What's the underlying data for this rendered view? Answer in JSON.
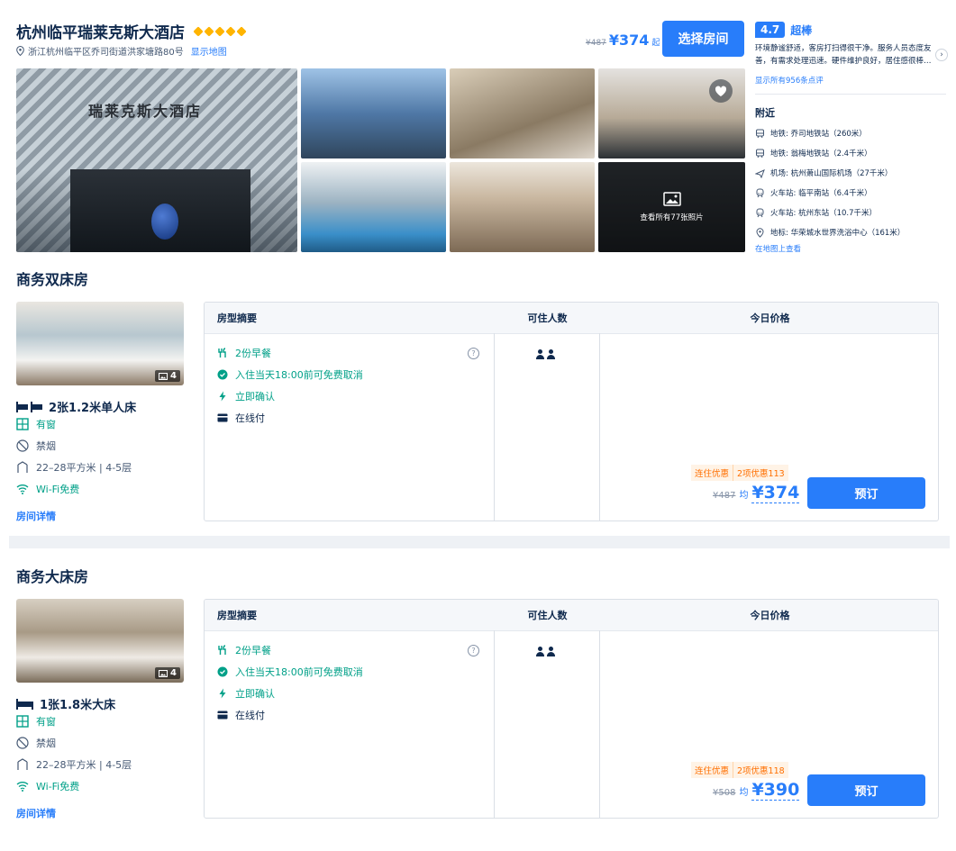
{
  "hotel": {
    "name": "杭州临平瑞莱克斯大酒店",
    "stars": 5,
    "address": "浙江杭州临平区乔司街道洪家塘路80号",
    "show_map": "显示地图",
    "price_old": "¥487",
    "price_new": "¥374",
    "price_suffix": "起",
    "select_button": "选择房间"
  },
  "review": {
    "score": "4.7",
    "word": "超棒",
    "text": "环境静谧舒适，客房打扫得很干净。服务人员态度友善，有需求处理迅速。硬件维护良好，居住感很棒…",
    "all_reviews": "显示所有956条点评"
  },
  "nearby": {
    "title": "附近",
    "items": [
      {
        "icon": "metro-icon",
        "label": "地铁: 乔司地铁站（260米）"
      },
      {
        "icon": "metro-icon",
        "label": "地铁: 翁梅地铁站（2.4千米）"
      },
      {
        "icon": "plane-icon",
        "label": "机场: 杭州萧山国际机场（27千米）"
      },
      {
        "icon": "train-icon",
        "label": "火车站: 临平南站（6.4千米）"
      },
      {
        "icon": "train-icon",
        "label": "火车站: 杭州东站（10.7千米）"
      },
      {
        "icon": "landmark-icon",
        "label": "地标: 华荣城水世界洗浴中心（161米）"
      }
    ],
    "map_view": "在地图上查看"
  },
  "gallery": {
    "view_all": "查看所有77张照片",
    "main_sign": "瑞莱克斯大酒店"
  },
  "rooms": [
    {
      "title": "商务双床房",
      "img_count": "4",
      "bed": "2张1.2米单人床",
      "window": "有窗",
      "smoking": "禁烟",
      "area": "22–28平方米 | 4-5层",
      "wifi": "Wi-Fi免费",
      "detail": "房间详情",
      "headers": {
        "summary": "房型摘要",
        "occupancy": "可住人数",
        "price": "今日价格"
      },
      "breakfast": "2份早餐",
      "cancel": "入住当天18:00前可免费取消",
      "confirm": "立即确认",
      "pay": "在线付",
      "promo_a": "连住优惠",
      "promo_b": "2项优惠113",
      "price_old": "¥487",
      "avg": "均",
      "price_new": "¥374",
      "book": "预订"
    },
    {
      "title": "商务大床房",
      "img_count": "4",
      "bed": "1张1.8米大床",
      "window": "有窗",
      "smoking": "禁烟",
      "area": "22–28平方米 | 4-5层",
      "wifi": "Wi-Fi免费",
      "detail": "房间详情",
      "headers": {
        "summary": "房型摘要",
        "occupancy": "可住人数",
        "price": "今日价格"
      },
      "breakfast": "2份早餐",
      "cancel": "入住当天18:00前可免费取消",
      "confirm": "立即确认",
      "pay": "在线付",
      "promo_a": "连住优惠",
      "promo_b": "2项优惠118",
      "price_old": "¥508",
      "avg": "均",
      "price_new": "¥390",
      "book": "预订"
    }
  ],
  "colors": {
    "accent": "#287dfa",
    "green": "#00a088",
    "promo": "#ff6f00",
    "star": "#ffb400"
  }
}
